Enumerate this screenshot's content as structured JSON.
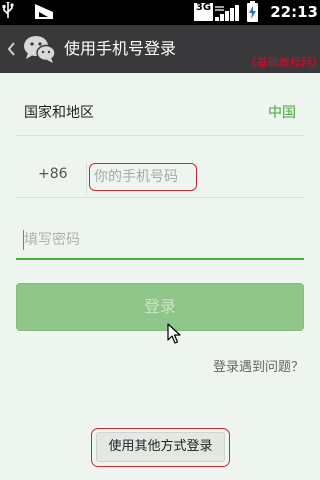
{
  "status_bar": {
    "network_type": "3G",
    "time": "22:13",
    "icons": [
      "usb-icon",
      "debug-icon",
      "signal-icon",
      "battery-charging-icon"
    ]
  },
  "header": {
    "back_icon": "chevron-left-icon",
    "logo_icon": "wechat-logo-icon",
    "title": "使用手机号登录",
    "watermark": "《基础教程网》"
  },
  "form": {
    "country_label": "国家和地区",
    "country_value": "中国",
    "country_code": "+86",
    "phone_placeholder": "你的手机号码",
    "phone_value": "",
    "password_placeholder": "填写密码",
    "password_value": "",
    "login_button": "登录"
  },
  "links": {
    "trouble": "登录遇到问题？"
  },
  "footer": {
    "other_method_button": "使用其他方式登录"
  },
  "colors": {
    "accent_green": "#45a53a",
    "login_button_disabled": "#8fc588",
    "highlight_red": "#d6232d",
    "title_bar": "#39393b",
    "background": "#eef5ef"
  }
}
